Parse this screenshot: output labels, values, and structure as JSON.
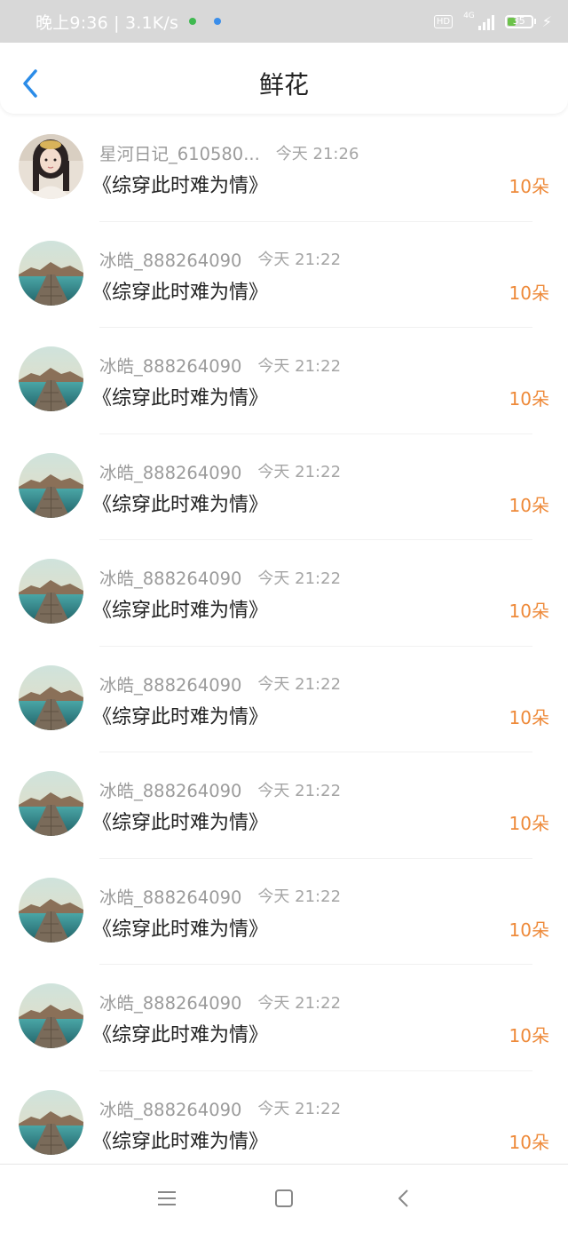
{
  "status_bar": {
    "time_speed": "晚上9:36 | 3.1K/s",
    "hd": "HD",
    "network": "4G",
    "battery": "35",
    "battery_level": 0.35
  },
  "header": {
    "title": "鲜花",
    "back_icon": "chevron-left-icon"
  },
  "rows": [
    {
      "name": "星河日记_610580...",
      "time": "今天 21:26",
      "book": "《综穿此时难为情》",
      "count": "10朵",
      "avatar": "portrait-avatar"
    },
    {
      "name": "冰皓_888264090",
      "time": "今天 21:22",
      "book": "《综穿此时难为情》",
      "count": "10朵",
      "avatar": "lake-pier-avatar"
    },
    {
      "name": "冰皓_888264090",
      "time": "今天 21:22",
      "book": "《综穿此时难为情》",
      "count": "10朵",
      "avatar": "lake-pier-avatar"
    },
    {
      "name": "冰皓_888264090",
      "time": "今天 21:22",
      "book": "《综穿此时难为情》",
      "count": "10朵",
      "avatar": "lake-pier-avatar"
    },
    {
      "name": "冰皓_888264090",
      "time": "今天 21:22",
      "book": "《综穿此时难为情》",
      "count": "10朵",
      "avatar": "lake-pier-avatar"
    },
    {
      "name": "冰皓_888264090",
      "time": "今天 21:22",
      "book": "《综穿此时难为情》",
      "count": "10朵",
      "avatar": "lake-pier-avatar"
    },
    {
      "name": "冰皓_888264090",
      "time": "今天 21:22",
      "book": "《综穿此时难为情》",
      "count": "10朵",
      "avatar": "lake-pier-avatar"
    },
    {
      "name": "冰皓_888264090",
      "time": "今天 21:22",
      "book": "《综穿此时难为情》",
      "count": "10朵",
      "avatar": "lake-pier-avatar"
    },
    {
      "name": "冰皓_888264090",
      "time": "今天 21:22",
      "book": "《综穿此时难为情》",
      "count": "10朵",
      "avatar": "lake-pier-avatar"
    },
    {
      "name": "冰皓_888264090",
      "time": "今天 21:22",
      "book": "《综穿此时难为情》",
      "count": "10朵",
      "avatar": "lake-pier-avatar"
    }
  ],
  "nav_bar": {
    "menu_icon": "menu-icon",
    "home_icon": "home-square-icon",
    "back_icon": "back-triangle-icon"
  },
  "colors": {
    "accent": "#2b8ce8",
    "flower_count": "#ee8a3a",
    "meta_text": "#9b9b9b"
  }
}
